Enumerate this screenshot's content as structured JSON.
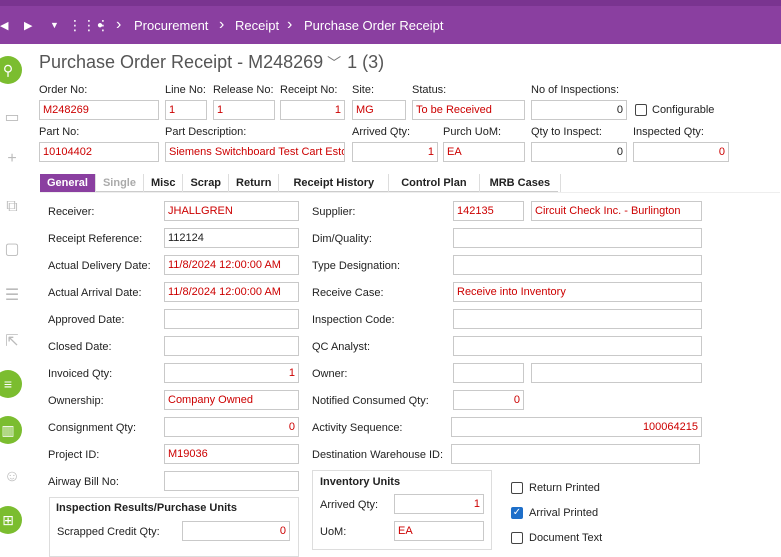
{
  "breadcrumb": [
    "Procurement",
    "Receipt",
    "Purchase Order Receipt"
  ],
  "title": {
    "text": "Purchase Order Receipt - M248269",
    "counter": "1 (3)"
  },
  "header": {
    "order_no": {
      "label": "Order No:",
      "value": "M248269"
    },
    "line_no": {
      "label": "Line No:",
      "value": "1"
    },
    "release_no": {
      "label": "Release No:",
      "value": "1"
    },
    "receipt_no": {
      "label": "Receipt No:",
      "value": "1"
    },
    "site": {
      "label": "Site:",
      "value": "MG"
    },
    "status": {
      "label": "Status:",
      "value": "To be Received"
    },
    "no_inspections": {
      "label": "No of Inspections:",
      "value": "0"
    },
    "configurable": {
      "label": "Configurable",
      "checked": false
    },
    "part_no": {
      "label": "Part No:",
      "value": "10104402"
    },
    "part_desc": {
      "label": "Part Description:",
      "value": "Siemens Switchboard Test Cart Estop"
    },
    "arrived_qty": {
      "label": "Arrived Qty:",
      "value": "1"
    },
    "purch_uom": {
      "label": "Purch UoM:",
      "value": "EA"
    },
    "qty_inspect": {
      "label": "Qty to Inspect:",
      "value": "0"
    },
    "inspected_qty": {
      "label": "Inspected Qty:",
      "value": "0"
    }
  },
  "tabs": [
    {
      "label": "General",
      "active": true
    },
    {
      "label": "Single",
      "disabled": true
    },
    {
      "label": "Misc"
    },
    {
      "label": "Scrap"
    },
    {
      "label": "Return"
    },
    {
      "label": "Receipt History"
    },
    {
      "label": "Control Plan"
    },
    {
      "label": "MRB Cases"
    }
  ],
  "general": {
    "receiver": {
      "label": "Receiver:",
      "value": "JHALLGREN"
    },
    "receipt_ref": {
      "label": "Receipt Reference:",
      "value": "112124"
    },
    "actual_delivery": {
      "label": "Actual Delivery Date:",
      "value": "11/8/2024 12:00:00 AM"
    },
    "actual_arrival": {
      "label": "Actual Arrival Date:",
      "value": "11/8/2024 12:00:00 AM"
    },
    "approved_date": {
      "label": "Approved Date:",
      "value": ""
    },
    "closed_date": {
      "label": "Closed Date:",
      "value": ""
    },
    "invoiced_qty": {
      "label": "Invoiced Qty:",
      "value": "1"
    },
    "ownership": {
      "label": "Ownership:",
      "value": "Company Owned"
    },
    "consignment_qty": {
      "label": "Consignment Qty:",
      "value": "0"
    },
    "project_id": {
      "label": "Project ID:",
      "value": "M19036"
    },
    "airway_bill": {
      "label": "Airway Bill No:",
      "value": ""
    },
    "supplier": {
      "label": "Supplier:",
      "value": "142135",
      "name": "Circuit Check Inc. - Burlington"
    },
    "dim_quality": {
      "label": "Dim/Quality:",
      "value": ""
    },
    "type_designation": {
      "label": "Type Designation:",
      "value": ""
    },
    "receive_case": {
      "label": "Receive Case:",
      "value": "Receive into Inventory"
    },
    "inspection_code": {
      "label": "Inspection Code:",
      "value": ""
    },
    "qc_analyst": {
      "label": "QC Analyst:",
      "value": ""
    },
    "owner": {
      "label": "Owner:",
      "value": "",
      "name": ""
    },
    "notified_consumed": {
      "label": "Notified Consumed Qty:",
      "value": "0"
    },
    "activity_sequence": {
      "label": "Activity Sequence:",
      "value": "100064215"
    },
    "dest_warehouse": {
      "label": "Destination Warehouse ID:",
      "value": ""
    }
  },
  "inspection_group": {
    "title": "Inspection Results/Purchase Units",
    "scrapped_credit": {
      "label": "Scrapped Credit Qty:",
      "value": "0"
    }
  },
  "inventory_group": {
    "title": "Inventory Units",
    "arrived_qty": {
      "label": "Arrived Qty:",
      "value": "1"
    },
    "uom": {
      "label": "UoM:",
      "value": "EA"
    }
  },
  "checkboxes": {
    "return_printed": {
      "label": "Return Printed",
      "checked": false
    },
    "arrival_printed": {
      "label": "Arrival Printed",
      "checked": true
    },
    "document_text": {
      "label": "Document Text",
      "checked": false
    }
  }
}
